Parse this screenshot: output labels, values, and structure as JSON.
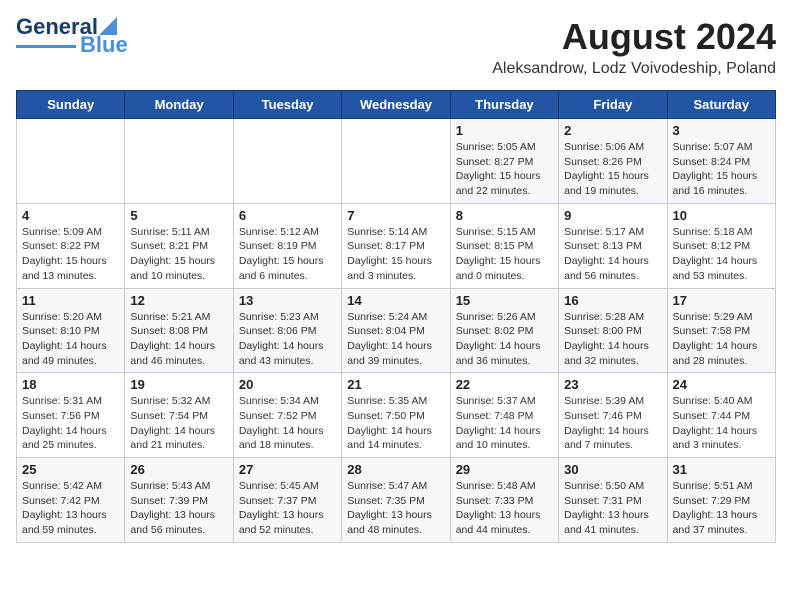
{
  "logo": {
    "line1": "General",
    "line2": "Blue"
  },
  "title": "August 2024",
  "subtitle": "Aleksandrow, Lodz Voivodeship, Poland",
  "days_of_week": [
    "Sunday",
    "Monday",
    "Tuesday",
    "Wednesday",
    "Thursday",
    "Friday",
    "Saturday"
  ],
  "weeks": [
    [
      {
        "day": "",
        "info": ""
      },
      {
        "day": "",
        "info": ""
      },
      {
        "day": "",
        "info": ""
      },
      {
        "day": "",
        "info": ""
      },
      {
        "day": "1",
        "info": "Sunrise: 5:05 AM\nSunset: 8:27 PM\nDaylight: 15 hours\nand 22 minutes."
      },
      {
        "day": "2",
        "info": "Sunrise: 5:06 AM\nSunset: 8:26 PM\nDaylight: 15 hours\nand 19 minutes."
      },
      {
        "day": "3",
        "info": "Sunrise: 5:07 AM\nSunset: 8:24 PM\nDaylight: 15 hours\nand 16 minutes."
      }
    ],
    [
      {
        "day": "4",
        "info": "Sunrise: 5:09 AM\nSunset: 8:22 PM\nDaylight: 15 hours\nand 13 minutes."
      },
      {
        "day": "5",
        "info": "Sunrise: 5:11 AM\nSunset: 8:21 PM\nDaylight: 15 hours\nand 10 minutes."
      },
      {
        "day": "6",
        "info": "Sunrise: 5:12 AM\nSunset: 8:19 PM\nDaylight: 15 hours\nand 6 minutes."
      },
      {
        "day": "7",
        "info": "Sunrise: 5:14 AM\nSunset: 8:17 PM\nDaylight: 15 hours\nand 3 minutes."
      },
      {
        "day": "8",
        "info": "Sunrise: 5:15 AM\nSunset: 8:15 PM\nDaylight: 15 hours\nand 0 minutes."
      },
      {
        "day": "9",
        "info": "Sunrise: 5:17 AM\nSunset: 8:13 PM\nDaylight: 14 hours\nand 56 minutes."
      },
      {
        "day": "10",
        "info": "Sunrise: 5:18 AM\nSunset: 8:12 PM\nDaylight: 14 hours\nand 53 minutes."
      }
    ],
    [
      {
        "day": "11",
        "info": "Sunrise: 5:20 AM\nSunset: 8:10 PM\nDaylight: 14 hours\nand 49 minutes."
      },
      {
        "day": "12",
        "info": "Sunrise: 5:21 AM\nSunset: 8:08 PM\nDaylight: 14 hours\nand 46 minutes."
      },
      {
        "day": "13",
        "info": "Sunrise: 5:23 AM\nSunset: 8:06 PM\nDaylight: 14 hours\nand 43 minutes."
      },
      {
        "day": "14",
        "info": "Sunrise: 5:24 AM\nSunset: 8:04 PM\nDaylight: 14 hours\nand 39 minutes."
      },
      {
        "day": "15",
        "info": "Sunrise: 5:26 AM\nSunset: 8:02 PM\nDaylight: 14 hours\nand 36 minutes."
      },
      {
        "day": "16",
        "info": "Sunrise: 5:28 AM\nSunset: 8:00 PM\nDaylight: 14 hours\nand 32 minutes."
      },
      {
        "day": "17",
        "info": "Sunrise: 5:29 AM\nSunset: 7:58 PM\nDaylight: 14 hours\nand 28 minutes."
      }
    ],
    [
      {
        "day": "18",
        "info": "Sunrise: 5:31 AM\nSunset: 7:56 PM\nDaylight: 14 hours\nand 25 minutes."
      },
      {
        "day": "19",
        "info": "Sunrise: 5:32 AM\nSunset: 7:54 PM\nDaylight: 14 hours\nand 21 minutes."
      },
      {
        "day": "20",
        "info": "Sunrise: 5:34 AM\nSunset: 7:52 PM\nDaylight: 14 hours\nand 18 minutes."
      },
      {
        "day": "21",
        "info": "Sunrise: 5:35 AM\nSunset: 7:50 PM\nDaylight: 14 hours\nand 14 minutes."
      },
      {
        "day": "22",
        "info": "Sunrise: 5:37 AM\nSunset: 7:48 PM\nDaylight: 14 hours\nand 10 minutes."
      },
      {
        "day": "23",
        "info": "Sunrise: 5:39 AM\nSunset: 7:46 PM\nDaylight: 14 hours\nand 7 minutes."
      },
      {
        "day": "24",
        "info": "Sunrise: 5:40 AM\nSunset: 7:44 PM\nDaylight: 14 hours\nand 3 minutes."
      }
    ],
    [
      {
        "day": "25",
        "info": "Sunrise: 5:42 AM\nSunset: 7:42 PM\nDaylight: 13 hours\nand 59 minutes."
      },
      {
        "day": "26",
        "info": "Sunrise: 5:43 AM\nSunset: 7:39 PM\nDaylight: 13 hours\nand 56 minutes."
      },
      {
        "day": "27",
        "info": "Sunrise: 5:45 AM\nSunset: 7:37 PM\nDaylight: 13 hours\nand 52 minutes."
      },
      {
        "day": "28",
        "info": "Sunrise: 5:47 AM\nSunset: 7:35 PM\nDaylight: 13 hours\nand 48 minutes."
      },
      {
        "day": "29",
        "info": "Sunrise: 5:48 AM\nSunset: 7:33 PM\nDaylight: 13 hours\nand 44 minutes."
      },
      {
        "day": "30",
        "info": "Sunrise: 5:50 AM\nSunset: 7:31 PM\nDaylight: 13 hours\nand 41 minutes."
      },
      {
        "day": "31",
        "info": "Sunrise: 5:51 AM\nSunset: 7:29 PM\nDaylight: 13 hours\nand 37 minutes."
      }
    ]
  ]
}
